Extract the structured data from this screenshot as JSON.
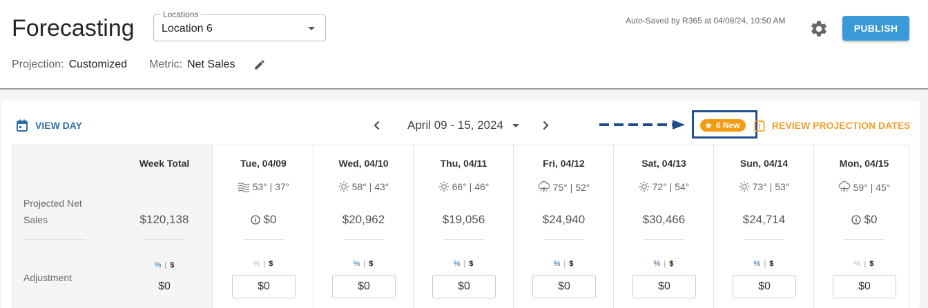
{
  "header": {
    "title": "Forecasting",
    "location_legend": "Locations",
    "location_value": "Location 6",
    "projection_label": "Projection:",
    "projection_value": "Customized",
    "metric_label": "Metric:",
    "metric_value": "Net Sales",
    "autosave": "Auto-Saved by R365 at 04/08/24, 10:50 AM",
    "publish_label": "PUBLISH"
  },
  "toolbar": {
    "view_day": "VIEW DAY",
    "date_range": "April 09 - 15, 2024",
    "new_badge": "6 New",
    "review": "REVIEW PROJECTION DATES"
  },
  "grid": {
    "week_total_header": "Week Total",
    "projected_label_1": "Projected Net",
    "projected_label_2": "Sales",
    "adjustment_label": "Adjustment",
    "week_total_sales": "$120,138",
    "week_total_adjustment": "$0",
    "pct_symbol": "%",
    "sep_symbol": "|",
    "dollar_symbol": "$",
    "days": [
      {
        "header": "Tue, 04/09",
        "weather_icon": "fog-icon",
        "temps": "53° | 37°",
        "sales": "$0",
        "sales_info": true,
        "adjustment": "$0",
        "pct_dim": true
      },
      {
        "header": "Wed, 04/10",
        "weather_icon": "sun-icon",
        "temps": "58° | 43°",
        "sales": "$20,962",
        "sales_info": false,
        "adjustment": "$0",
        "pct_dim": false
      },
      {
        "header": "Thu, 04/11",
        "weather_icon": "sun-icon",
        "temps": "66° | 46°",
        "sales": "$19,056",
        "sales_info": false,
        "adjustment": "$0",
        "pct_dim": false
      },
      {
        "header": "Fri, 04/12",
        "weather_icon": "storm-cloud-icon",
        "temps": "75° | 52°",
        "sales": "$24,940",
        "sales_info": false,
        "adjustment": "$0",
        "pct_dim": false
      },
      {
        "header": "Sat, 04/13",
        "weather_icon": "sun-icon",
        "temps": "72° | 54°",
        "sales": "$30,466",
        "sales_info": false,
        "adjustment": "$0",
        "pct_dim": false
      },
      {
        "header": "Sun, 04/14",
        "weather_icon": "sun-icon",
        "temps": "73° | 53°",
        "sales": "$24,714",
        "sales_info": false,
        "adjustment": "$0",
        "pct_dim": false
      },
      {
        "header": "Mon, 04/15",
        "weather_icon": "storm-cloud-icon",
        "temps": "59° | 45°",
        "sales": "$0",
        "sales_info": true,
        "adjustment": "$0",
        "pct_dim": true
      }
    ]
  },
  "colors": {
    "publish": "#3a9ad9",
    "link_blue": "#2e6ea6",
    "badge_orange": "#f39c12",
    "review_orange": "#f0a030",
    "annotation_blue": "#1f4e8c"
  }
}
